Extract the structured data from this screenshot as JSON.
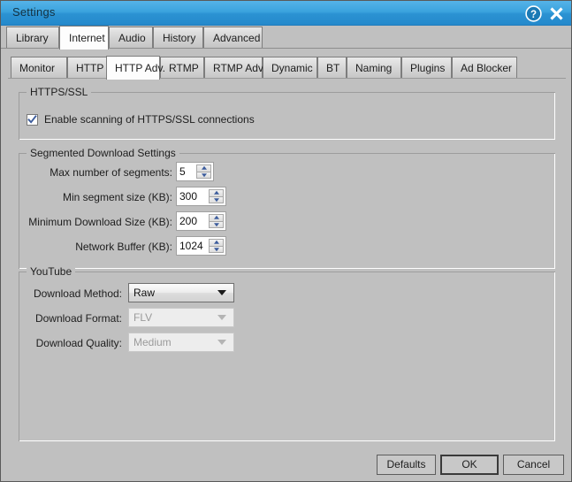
{
  "window": {
    "title": "Settings",
    "help_icon": "help-circle-icon",
    "close_icon": "close-icon"
  },
  "main_tabs": [
    {
      "label": "Library",
      "selected": false
    },
    {
      "label": "Internet",
      "selected": true
    },
    {
      "label": "Audio",
      "selected": false
    },
    {
      "label": "History",
      "selected": false
    },
    {
      "label": "Advanced",
      "selected": false
    }
  ],
  "sub_tabs": [
    {
      "label": "Monitor",
      "selected": false
    },
    {
      "label": "HTTP",
      "selected": false
    },
    {
      "label": "HTTP Adv.",
      "selected": true
    },
    {
      "label": "RTMP",
      "selected": false
    },
    {
      "label": "RTMP Adv.",
      "selected": false
    },
    {
      "label": "Dynamic",
      "selected": false
    },
    {
      "label": "BT",
      "selected": false
    },
    {
      "label": "Naming",
      "selected": false
    },
    {
      "label": "Plugins",
      "selected": false
    },
    {
      "label": "Ad Blocker",
      "selected": false
    }
  ],
  "https_group": {
    "title": "HTTPS/SSL",
    "checkbox": {
      "label": "Enable scanning of HTTPS/SSL connections",
      "checked": true
    }
  },
  "segmented_group": {
    "title": "Segmented Download Settings",
    "fields": [
      {
        "label": "Max number of segments:",
        "value": "5"
      },
      {
        "label": "Min segment size (KB):",
        "value": "300"
      },
      {
        "label": "Minimum Download Size (KB):",
        "value": "200"
      },
      {
        "label": "Network Buffer (KB):",
        "value": "1024"
      }
    ]
  },
  "youtube_group": {
    "title": "YouTube",
    "fields": [
      {
        "label": "Download Method:",
        "value": "Raw",
        "enabled": true
      },
      {
        "label": "Download Format:",
        "value": "FLV",
        "enabled": false
      },
      {
        "label": "Download Quality:",
        "value": "Medium",
        "enabled": false
      }
    ]
  },
  "footer": {
    "defaults_label": "Defaults",
    "ok_label": "OK",
    "cancel_label": "Cancel"
  },
  "colors": {
    "titlebar_start": "#55b3e8",
    "titlebar_end": "#2489cc",
    "dialog_bg": "#c0c0c0",
    "accent_check": "#3c5c9c"
  }
}
